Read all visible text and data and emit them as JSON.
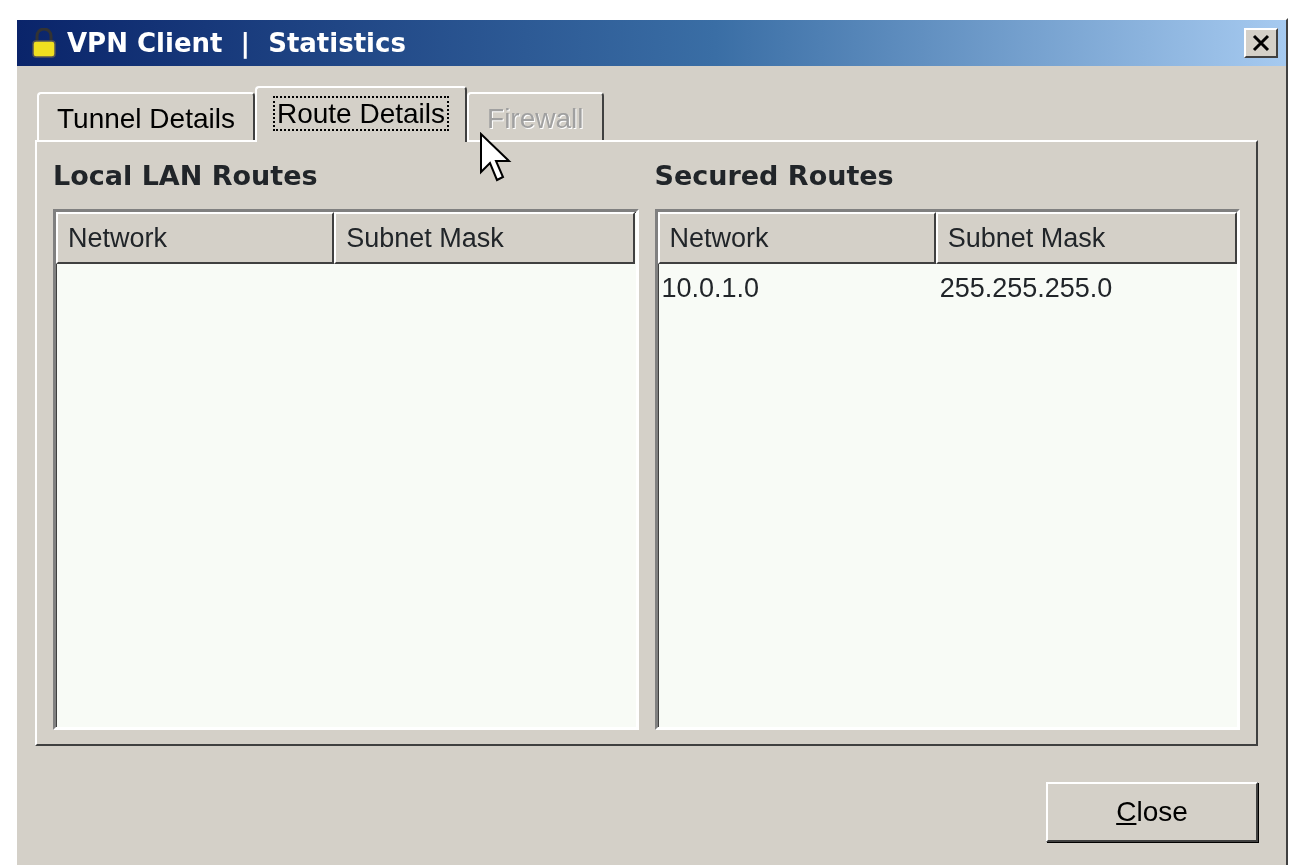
{
  "window": {
    "title": "VPN Client  |  Statistics"
  },
  "tabs": [
    {
      "label": "Tunnel Details",
      "selected": false,
      "disabled": false
    },
    {
      "label": "Route Details",
      "selected": true,
      "disabled": false
    },
    {
      "label": "Firewall",
      "selected": false,
      "disabled": true
    }
  ],
  "panels": [
    {
      "title": "Local LAN Routes",
      "columns": [
        "Network",
        "Subnet Mask"
      ]
    },
    {
      "title": "Secured Routes",
      "columns": [
        "Network",
        "Subnet Mask"
      ],
      "rows": [
        [
          "10.0.1.0",
          "255.255.255.0"
        ]
      ]
    }
  ],
  "buttons": [
    {
      "label": "Close"
    }
  ]
}
